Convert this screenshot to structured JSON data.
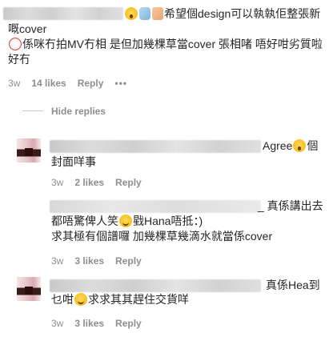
{
  "parent_comment": {
    "line1_text": "希望個design可以執執佢整張新",
    "line2_text": "嘅cover",
    "line3_text": "係咪冇拍MV冇相 是但加幾棵草當cover 張相啫 唔好咁劣質啦",
    "line4_text": "好冇",
    "meta": {
      "time": "3w",
      "likes": "14 likes",
      "reply": "Reply",
      "more": "•••"
    }
  },
  "hide_replies": "Hide replies",
  "replies": [
    {
      "suffix": "Agree",
      "suffix_end": "個",
      "line2": "封面咩事",
      "meta": {
        "time": "3w",
        "likes": "2 likes",
        "reply": "Reply"
      }
    },
    {
      "suffix": "_ 真係講出去",
      "line2_a": "都唔驚俾人笑",
      "line2_b": "戥Hana唔抵：)",
      "line3": "求其極有個譜囉 加幾棵草幾滴水就當係cover",
      "meta": {
        "time": "3w",
        "likes": "3 likes",
        "reply": "Reply"
      }
    },
    {
      "suffix": "真係Hea到",
      "line2_a": "乜咁",
      "line2_b": "求求其其趕住交貨咩",
      "meta": {
        "time": "3w",
        "likes": "3 likes",
        "reply": "Reply"
      }
    }
  ],
  "colors": {
    "text": "#262626",
    "meta": "#8e8e8e",
    "divider": "#c7c7c7"
  },
  "icons": [
    "shocked-face-icon",
    "wind-icon",
    "folded-hands-icon",
    "clown-face-icon",
    "grinning-face-icon"
  ]
}
